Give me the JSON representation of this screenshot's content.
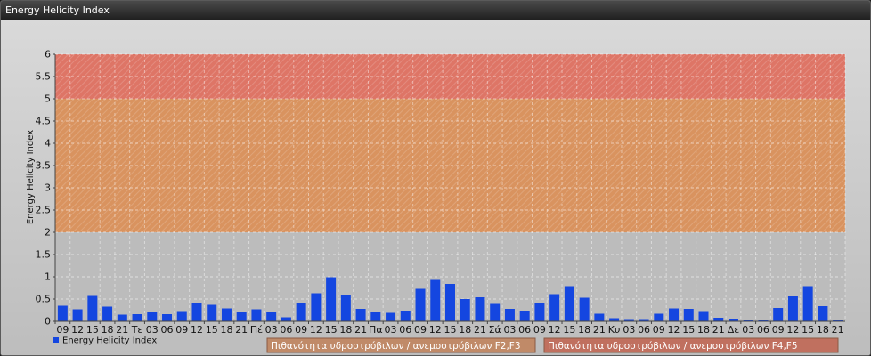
{
  "window": {
    "title": "Energy Helicity Index"
  },
  "chart_data": {
    "type": "bar",
    "title": "",
    "ylabel": "Energy Helicity Index",
    "xlabel": "",
    "ylim": [
      0,
      6
    ],
    "yticks": [
      "0",
      "0.5",
      "1",
      "1.5",
      "2",
      "2.5",
      "3",
      "3.5",
      "4",
      "4.5",
      "5",
      "5.5",
      "6"
    ],
    "categories": [
      "09",
      "12",
      "15",
      "18",
      "21",
      "Τε",
      "03",
      "06",
      "09",
      "12",
      "15",
      "18",
      "21",
      "Πέ",
      "03",
      "06",
      "09",
      "12",
      "15",
      "18",
      "21",
      "Πα",
      "03",
      "06",
      "09",
      "12",
      "15",
      "18",
      "21",
      "Σά",
      "03",
      "06",
      "09",
      "12",
      "15",
      "18",
      "21",
      "Κυ",
      "03",
      "06",
      "09",
      "12",
      "15",
      "18",
      "21",
      "Δε",
      "03",
      "06",
      "09",
      "12",
      "15",
      "18",
      "21"
    ],
    "series": [
      {
        "name": "Energy Helicity Index",
        "color": "#1446e0",
        "values": [
          0.35,
          0.27,
          0.57,
          0.33,
          0.15,
          0.16,
          0.2,
          0.16,
          0.23,
          0.41,
          0.37,
          0.29,
          0.22,
          0.27,
          0.21,
          0.09,
          0.41,
          0.63,
          0.99,
          0.59,
          0.28,
          0.22,
          0.19,
          0.24,
          0.73,
          0.93,
          0.84,
          0.5,
          0.54,
          0.39,
          0.28,
          0.24,
          0.41,
          0.61,
          0.79,
          0.53,
          0.17,
          0.07,
          0.05,
          0.05,
          0.17,
          0.29,
          0.28,
          0.23,
          0.08,
          0.06,
          0.03,
          0.03,
          0.3,
          0.56,
          0.79,
          0.34,
          0.04
        ]
      }
    ],
    "bands": [
      {
        "from": 0,
        "to": 2,
        "color": "#bcbcbc"
      },
      {
        "from": 2,
        "to": 5,
        "color": "#d9935f",
        "label": "Πιθανότητα υδροστρόβιλων / ανεμοστρόβιλων F2,F3"
      },
      {
        "from": 5,
        "to": 6,
        "color": "#de7566",
        "label": "Πιθανότητα υδροστρόβιλων / ανεμοστρόβιλων F4,F5"
      }
    ],
    "grid": true,
    "legend": "bottom-left"
  }
}
